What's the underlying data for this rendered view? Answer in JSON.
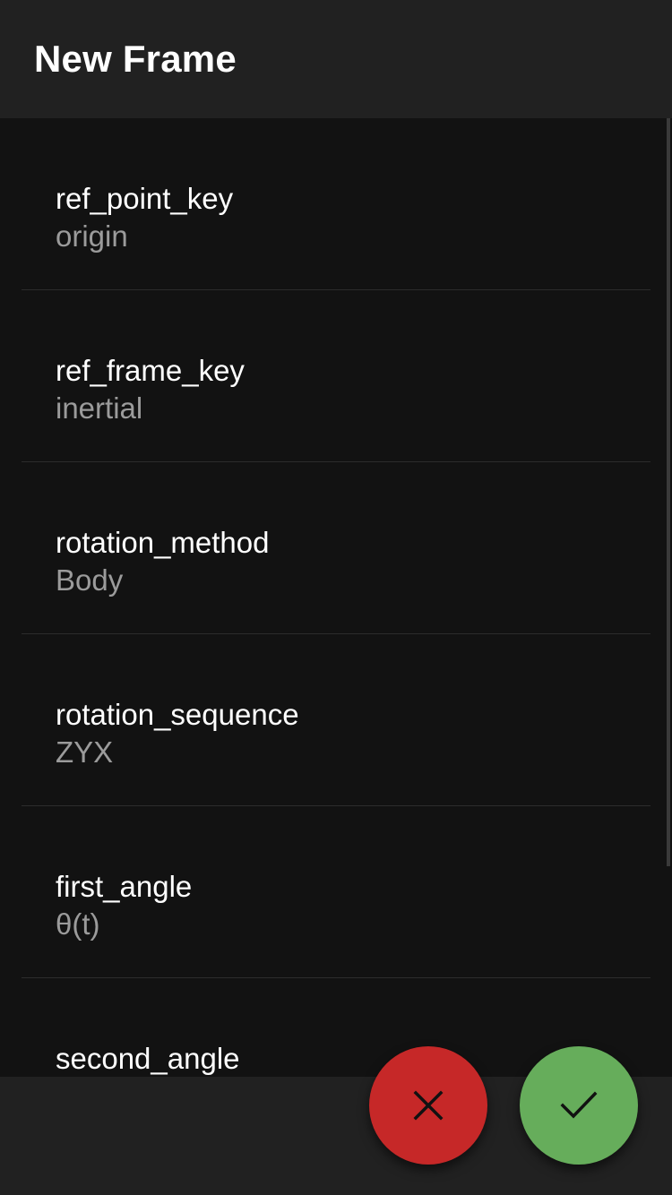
{
  "app_bar": {
    "title": "New Frame"
  },
  "fields": [
    {
      "label": "ref_point_key",
      "value": "origin"
    },
    {
      "label": "ref_frame_key",
      "value": "inertial"
    },
    {
      "label": "rotation_method",
      "value": "Body"
    },
    {
      "label": "rotation_sequence",
      "value": "ZYX"
    },
    {
      "label": "first_angle",
      "value": "θ(t)"
    },
    {
      "label": "second_angle",
      "value": ""
    }
  ],
  "actions": {
    "cancel_icon": "close-icon",
    "confirm_icon": "check-icon",
    "cancel_color": "#c62828",
    "confirm_color": "#66ad5b"
  },
  "colors": {
    "background": "#121212",
    "app_bar": "#212121",
    "primary_text": "#ffffff",
    "secondary_text": "#9b9b9b"
  }
}
